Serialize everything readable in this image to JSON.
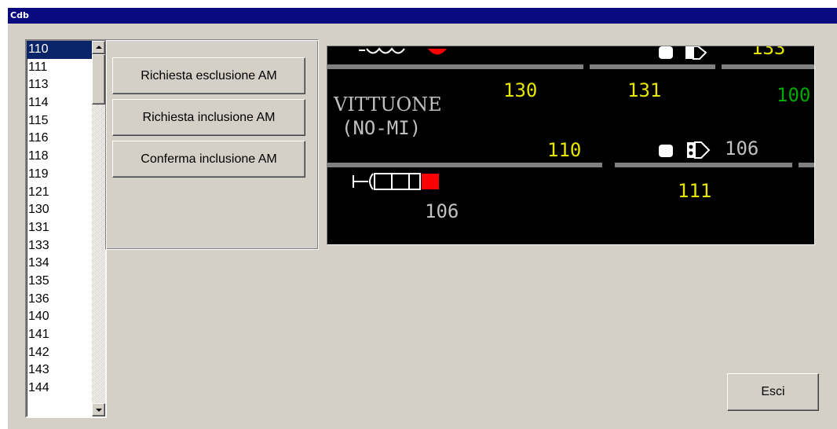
{
  "window": {
    "title": "Cdb"
  },
  "list": {
    "selected": "110",
    "items": [
      "110",
      "111",
      "113",
      "114",
      "115",
      "116",
      "118",
      "119",
      "121",
      "130",
      "131",
      "133",
      "134",
      "135",
      "136",
      "140",
      "141",
      "142",
      "143",
      "144"
    ]
  },
  "buttons": {
    "exclude": "Richiesta esclusione AM",
    "include": "Richiesta inclusione AM",
    "confirm": "Conferma inclusione AM",
    "exit": "Esci"
  },
  "monitor": {
    "station_name": "VITTUONE",
    "station_region": "(NO-MI)",
    "top_partial_number": "133",
    "track_130": "130",
    "track_131": "131",
    "track_partial_green": "100",
    "track_110": "110",
    "signal_106_right": "106",
    "track_111": "111",
    "signal_106_left": "106",
    "colors": {
      "yellow": "#e6e600",
      "green": "#00aa00",
      "gray": "#c0c0c0",
      "rail": "#808080",
      "red": "#ff0000"
    }
  }
}
